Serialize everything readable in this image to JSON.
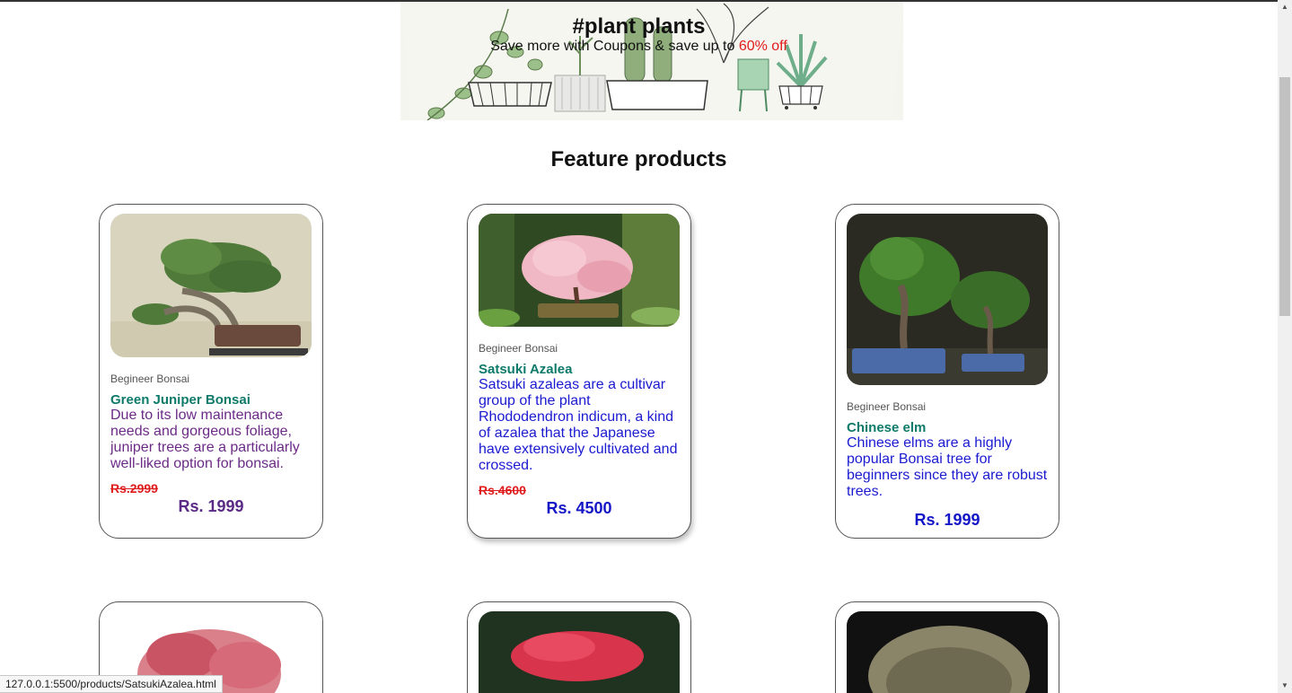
{
  "banner": {
    "title": "#plant plants",
    "subtitle_prefix": "Save more with Coupons & save up to ",
    "subtitle_offer": "60% off"
  },
  "section": {
    "title": "Feature products"
  },
  "products": [
    {
      "category": "Begineer Bonsai",
      "name": "Green Juniper Bonsai",
      "description": "Due to its low maintenance needs and gorgeous foliage, juniper trees are a particularly well-liked option for bonsai.",
      "old_price": "Rs.2999",
      "price": "Rs. 1999"
    },
    {
      "category": "Begineer Bonsai",
      "name": "Satsuki Azalea",
      "description": "Satsuki azaleas are a cultivar group of the plant Rhododendron indicum, a kind of azalea that the Japanese have extensively cultivated and crossed.",
      "old_price": "Rs.4600",
      "price": "Rs. 4500"
    },
    {
      "category": "Begineer Bonsai",
      "name": "Chinese elm",
      "description": "Chinese elms are a highly popular Bonsai tree for beginners since they are robust trees.",
      "old_price": "",
      "price": "Rs. 1999"
    }
  ],
  "status_bar": {
    "url": "127.0.0.1:5500/products/SatsukiAzalea.html"
  },
  "colors": {
    "accent_name": "#0d7a6a",
    "offer": "#e01b1b",
    "link": "#1a1ad0",
    "visited": "#6b2a86"
  }
}
